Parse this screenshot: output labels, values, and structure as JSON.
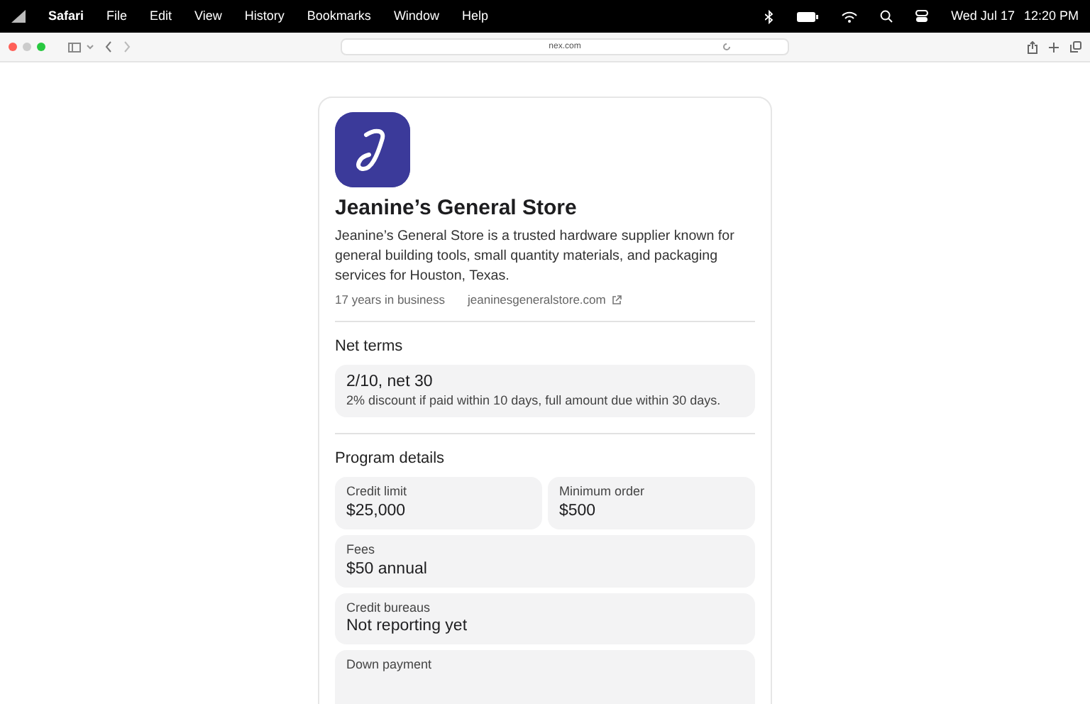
{
  "menu_bar": {
    "app": "Safari",
    "items": [
      "File",
      "Edit",
      "View",
      "History",
      "Bookmarks",
      "Window",
      "Help"
    ],
    "date": "Wed Jul 17",
    "time": "12:20 PM"
  },
  "toolbar": {
    "address": "nex.com"
  },
  "store": {
    "name": "Jeanine’s General Store",
    "description": "Jeanine’s General Store is a trusted hardware supplier known for general building tools, small quantity materials, and packaging services for Houston, Texas.",
    "years": "17 years in business",
    "website": "jeaninesgeneralstore.com"
  },
  "net_terms": {
    "heading": "Net terms",
    "title": "2/10, net 30",
    "detail": "2% discount if paid within 10 days, full amount due within 30 days."
  },
  "program_details": {
    "heading": "Program details",
    "items": [
      {
        "kind": "half",
        "label": "Credit limit",
        "value": "$25,000"
      },
      {
        "kind": "half",
        "label": "Minimum order",
        "value": "$500"
      },
      {
        "kind": "full",
        "label": "Fees",
        "value": "$50 annual"
      },
      {
        "kind": "full",
        "label": "Credit bureaus",
        "value": "Not reporting yet"
      },
      {
        "kind": "full",
        "label": "Down payment"
      }
    ]
  }
}
